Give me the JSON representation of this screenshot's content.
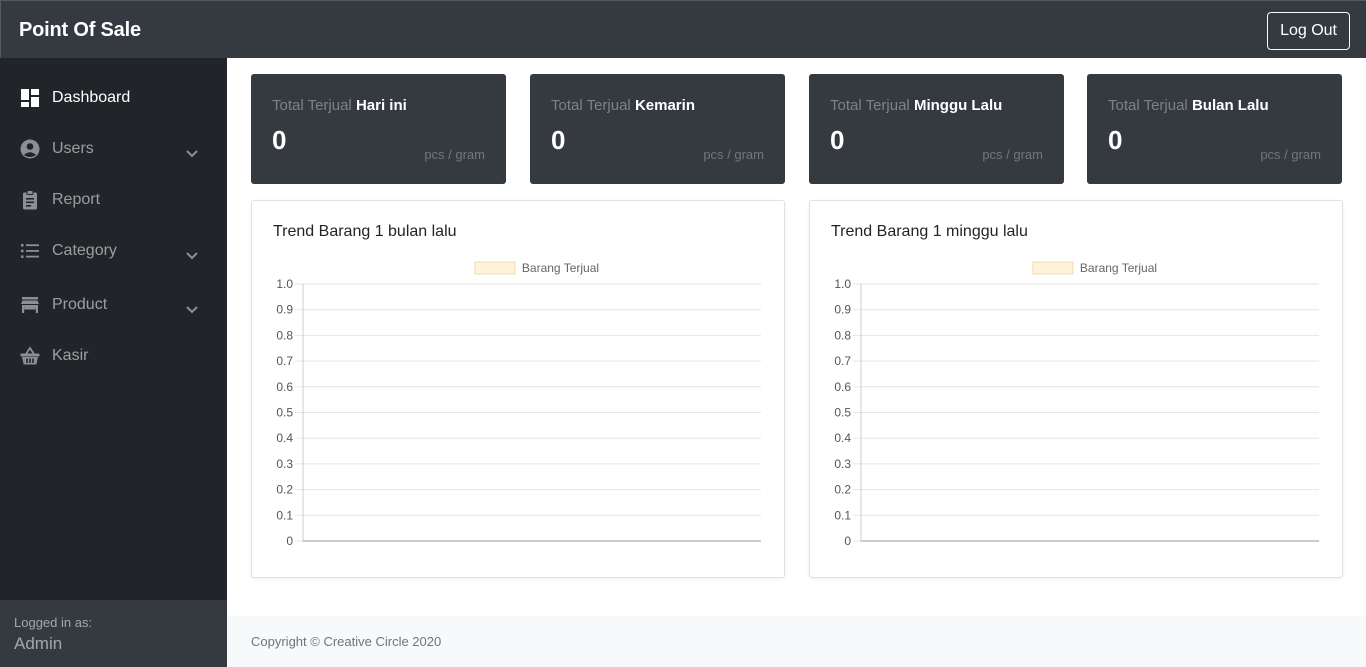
{
  "app": {
    "brand": "Point Of Sale",
    "logout_label": "Log Out"
  },
  "sidebar": {
    "items": [
      {
        "label": "Dashboard",
        "icon": "dashboard-icon",
        "active": true,
        "expandable": false
      },
      {
        "label": "Users",
        "icon": "user-circle-icon",
        "active": false,
        "expandable": true
      },
      {
        "label": "Report",
        "icon": "clipboard-icon",
        "active": false,
        "expandable": false
      },
      {
        "label": "Category",
        "icon": "list-icon",
        "active": false,
        "expandable": true
      },
      {
        "label": "Product",
        "icon": "store-icon",
        "active": false,
        "expandable": true
      },
      {
        "label": "Kasir",
        "icon": "basket-icon",
        "active": false,
        "expandable": false
      }
    ],
    "footer": {
      "logged_in_label": "Logged in as:",
      "user": "Admin"
    }
  },
  "stats": [
    {
      "prefix": "Total Terjual",
      "period": "Hari ini",
      "value": "0",
      "unit": "pcs / gram"
    },
    {
      "prefix": "Total Terjual",
      "period": "Kemarin",
      "value": "0",
      "unit": "pcs / gram"
    },
    {
      "prefix": "Total Terjual",
      "period": "Minggu Lalu",
      "value": "0",
      "unit": "pcs / gram"
    },
    {
      "prefix": "Total Terjual",
      "period": "Bulan Lalu",
      "value": "0",
      "unit": "pcs / gram"
    }
  ],
  "chart_data": [
    {
      "type": "bar",
      "title": "Trend Barang 1 bulan lalu",
      "categories": [],
      "series": [
        {
          "name": "Barang Terjual",
          "values": [],
          "color": "#fff3d9"
        }
      ],
      "ylim": [
        0,
        1
      ],
      "yticks": [
        "0",
        "0.1",
        "0.2",
        "0.3",
        "0.4",
        "0.5",
        "0.6",
        "0.7",
        "0.8",
        "0.9",
        "1.0"
      ],
      "grid": true,
      "legend": "top-center"
    },
    {
      "type": "bar",
      "title": "Trend Barang 1 minggu lalu",
      "categories": [],
      "series": [
        {
          "name": "Barang Terjual",
          "values": [],
          "color": "#fff3d9"
        }
      ],
      "ylim": [
        0,
        1
      ],
      "yticks": [
        "0",
        "0.1",
        "0.2",
        "0.3",
        "0.4",
        "0.5",
        "0.6",
        "0.7",
        "0.8",
        "0.9",
        "1.0"
      ],
      "grid": true,
      "legend": "top-center"
    }
  ],
  "footer": {
    "copyright": "Copyright © Creative Circle 2020"
  },
  "colors": {
    "topbar": "#343a40",
    "sidebar": "#212529",
    "card": "#343a40",
    "legend_fill": "#fff3d9"
  }
}
